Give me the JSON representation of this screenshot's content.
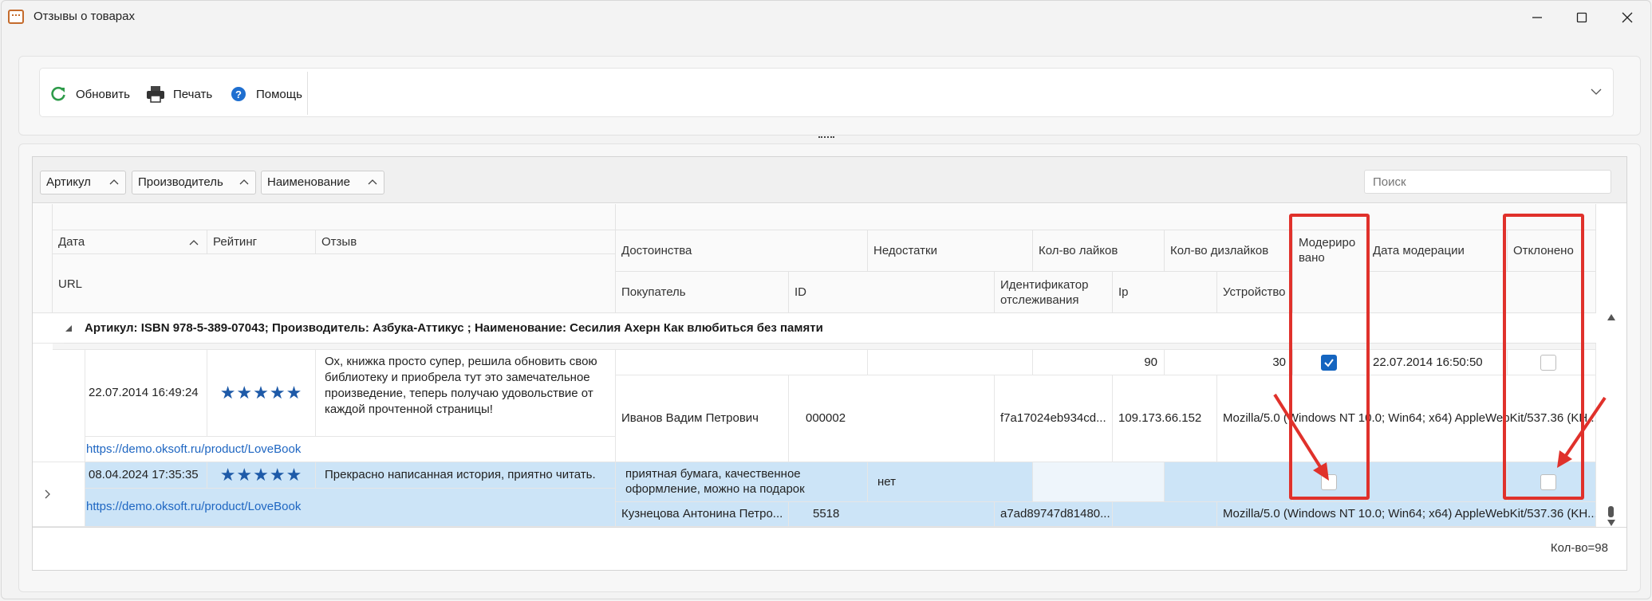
{
  "window": {
    "title": "Отзывы о товарах"
  },
  "toolbar": {
    "refresh": "Обновить",
    "print": "Печать",
    "help": "Помощь"
  },
  "grouping": {
    "chips": [
      "Артикул",
      "Производитель",
      "Наименование"
    ],
    "search_placeholder": "Поиск"
  },
  "headers": {
    "date": "Дата",
    "rating": "Рейтинг",
    "review": "Отзыв",
    "url": "URL",
    "pros": "Достоинства",
    "cons": "Недостатки",
    "likes": "Кол-во лайков",
    "dislikes": "Кол-во дизлайков",
    "moderated": "Модерировано",
    "mod_date": "Дата модерации",
    "rejected": "Отклонено",
    "buyer": "Покупатель",
    "id": "ID",
    "tracking": "Идентификатор отслеживания",
    "ip": "Ip",
    "device": "Устройство"
  },
  "group_row": "Артикул: ISBN 978-5-389-07043; Производитель: Азбука-Аттикус ; Наименование: Сесилия Ахерн Как влюбиться без памяти",
  "rows": [
    {
      "date": "22.07.2014 16:49:24",
      "stars": "★★★★★",
      "review": "Ох, книжка просто супер, решила обновить свою библиотеку и приобрела тут это замечательное произведение, теперь получаю удовольствие от каждой прочтенной страницы!",
      "url": "https://demo.oksoft.ru/product/LoveBook",
      "pros": "",
      "cons": "",
      "likes": "90",
      "dislikes": "30",
      "moderated": true,
      "mod_date": "22.07.2014 16:50:50",
      "rejected": false,
      "buyer": "Иванов Вадим Петрович",
      "id": "000002",
      "tracking": "f7a17024eb934cd...",
      "ip": "109.173.66.152",
      "device": "Mozilla/5.0 (Windows NT 10.0; Win64; x64) AppleWebKit/537.36 (KH..."
    },
    {
      "date": "08.04.2024 17:35:35",
      "stars": "★★★★★",
      "review": "Прекрасно написанная история, приятно читать.",
      "url": "https://demo.oksoft.ru/product/LoveBook",
      "pros": "приятная бумага, качественное оформление, можно на подарок",
      "cons": "нет",
      "likes": "",
      "dislikes": "",
      "moderated": false,
      "mod_date": "",
      "rejected": false,
      "buyer": "Кузнецова Антонина Петро...",
      "id": "5518",
      "tracking": "a7ad89747d81480...",
      "ip": "",
      "device": "Mozilla/5.0 (Windows NT 10.0; Win64; x64) AppleWebKit/537.36 (KH..."
    }
  ],
  "status": {
    "count": "Кол-во=98"
  },
  "colors": {
    "accent": "#1565c0",
    "selection": "#cce4f7",
    "highlight": "#e0312b",
    "link": "#1e66c2"
  }
}
